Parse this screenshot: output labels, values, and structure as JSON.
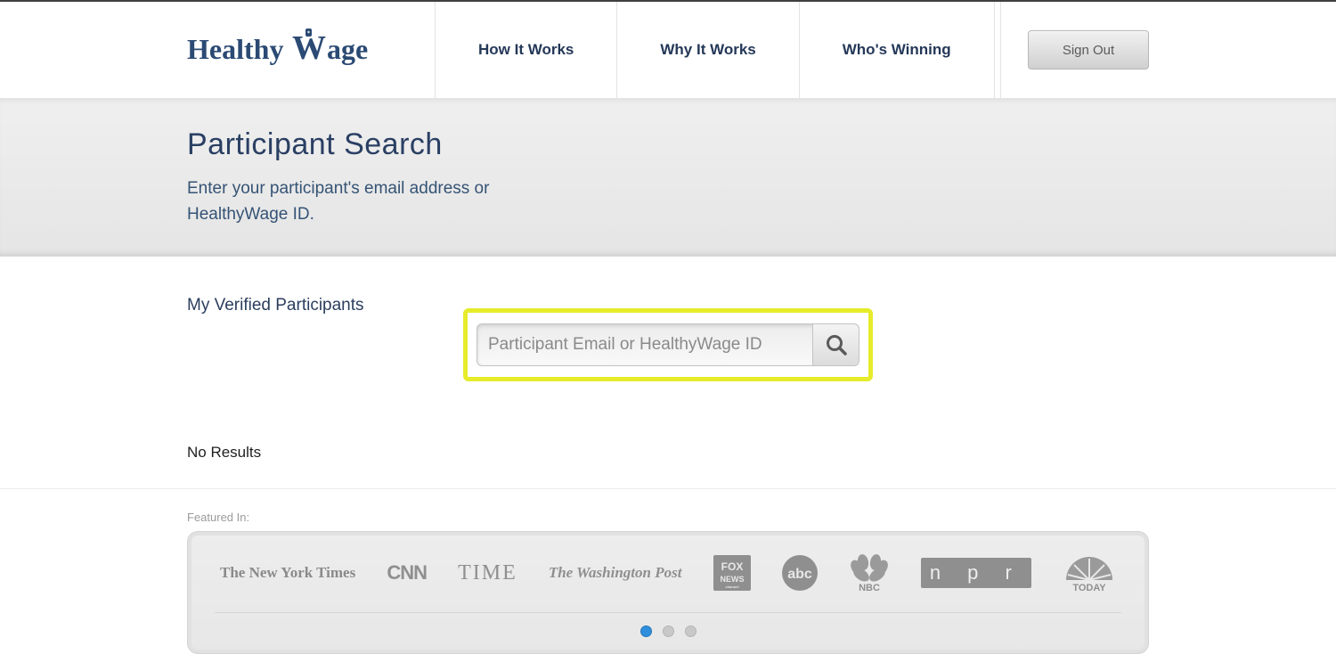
{
  "brand": {
    "name": "HealthyWage"
  },
  "nav": {
    "items": [
      {
        "label": "How It Works"
      },
      {
        "label": "Why It Works"
      },
      {
        "label": "Who's Winning"
      }
    ],
    "signout_label": "Sign Out"
  },
  "hero": {
    "title": "Participant Search",
    "subtitle": "Enter your participant's email address or HealthyWage ID."
  },
  "main": {
    "section_label": "My Verified Participants",
    "search_placeholder": "Participant Email or HealthyWage ID",
    "no_results": "No Results"
  },
  "featured": {
    "label": "Featured In:",
    "logos": [
      {
        "name": "The New York Times"
      },
      {
        "name": "CNN"
      },
      {
        "name": "TIME"
      },
      {
        "name": "The Washington Post"
      },
      {
        "name": "FOX NEWS"
      },
      {
        "name": "abc"
      },
      {
        "name": "NBC"
      },
      {
        "name": "n p r"
      },
      {
        "name": "TODAY"
      }
    ],
    "active_dot": 0,
    "dot_count": 3
  }
}
